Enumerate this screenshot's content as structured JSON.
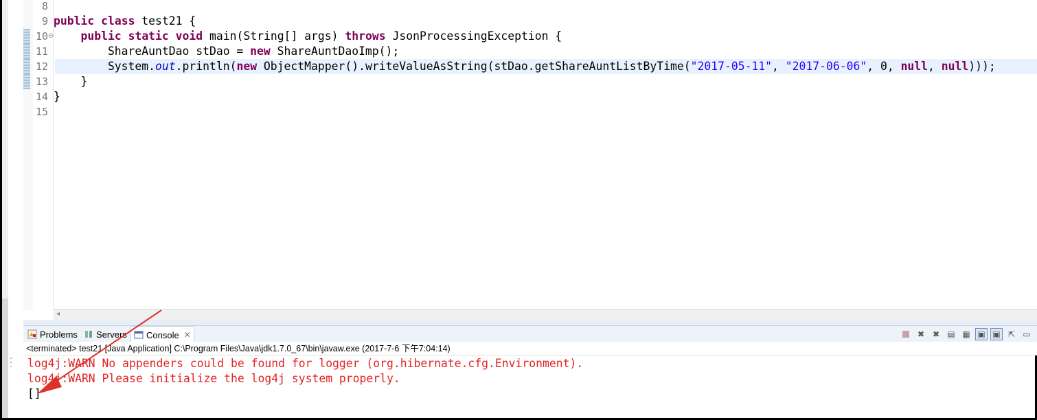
{
  "editor": {
    "lines": [
      {
        "num": "8",
        "tokens": []
      },
      {
        "num": "9",
        "tokens": [
          {
            "t": "kw",
            "v": "public"
          },
          {
            "t": "n",
            "v": " "
          },
          {
            "t": "kw",
            "v": "class"
          },
          {
            "t": "n",
            "v": " test21 {"
          }
        ]
      },
      {
        "num": "10",
        "tokens": [
          {
            "t": "n",
            "v": "    "
          },
          {
            "t": "kw",
            "v": "public"
          },
          {
            "t": "n",
            "v": " "
          },
          {
            "t": "kw",
            "v": "static"
          },
          {
            "t": "n",
            "v": " "
          },
          {
            "t": "kw",
            "v": "void"
          },
          {
            "t": "n",
            "v": " main(String[] args) "
          },
          {
            "t": "kw",
            "v": "throws"
          },
          {
            "t": "n",
            "v": " JsonProcessingException {"
          }
        ]
      },
      {
        "num": "11",
        "tokens": [
          {
            "t": "n",
            "v": "        ShareAuntDao stDao = "
          },
          {
            "t": "kw",
            "v": "new"
          },
          {
            "t": "n",
            "v": " ShareAuntDaoImp();"
          }
        ]
      },
      {
        "num": "12",
        "tokens": [
          {
            "t": "n",
            "v": "        System."
          },
          {
            "t": "it",
            "v": "out"
          },
          {
            "t": "n",
            "v": ".println("
          },
          {
            "t": "kw",
            "v": "new"
          },
          {
            "t": "n",
            "v": " ObjectMapper().writeValueAsString(stDao.getShareAuntListByTime("
          },
          {
            "t": "str",
            "v": "\"2017-05-11\""
          },
          {
            "t": "n",
            "v": ", "
          },
          {
            "t": "str",
            "v": "\"2017-06-06\""
          },
          {
            "t": "n",
            "v": ", 0, "
          },
          {
            "t": "kw",
            "v": "null"
          },
          {
            "t": "n",
            "v": ", "
          },
          {
            "t": "kw",
            "v": "null"
          },
          {
            "t": "n",
            "v": ")));"
          }
        ]
      },
      {
        "num": "13",
        "tokens": [
          {
            "t": "n",
            "v": "    }"
          }
        ]
      },
      {
        "num": "14",
        "tokens": [
          {
            "t": "n",
            "v": "}"
          }
        ]
      },
      {
        "num": "15",
        "tokens": []
      }
    ]
  },
  "panel": {
    "tabs": [
      {
        "label": "Problems",
        "icon": "problems-icon"
      },
      {
        "label": "Servers",
        "icon": "servers-icon"
      },
      {
        "label": "Console",
        "icon": "console-icon",
        "active": true
      }
    ],
    "status": "<terminated> test21 [Java Application] C:\\Program Files\\Java\\jdk1.7.0_67\\bin\\javaw.exe (2017-7-6 下午7:04:14)",
    "console_lines": [
      {
        "text": "log4j:WARN No appenders could be found for logger (org.hibernate.cfg.Environment).",
        "kind": "err"
      },
      {
        "text": "log4j:WARN Please initialize the log4j system properly.",
        "kind": "err"
      },
      {
        "text": "[]",
        "kind": "out"
      }
    ]
  },
  "colors": {
    "keyword": "#7f0055",
    "string": "#2a00ff",
    "field": "#0000c0",
    "error": "#e32323",
    "annotation_arrow": "#e0302a"
  }
}
